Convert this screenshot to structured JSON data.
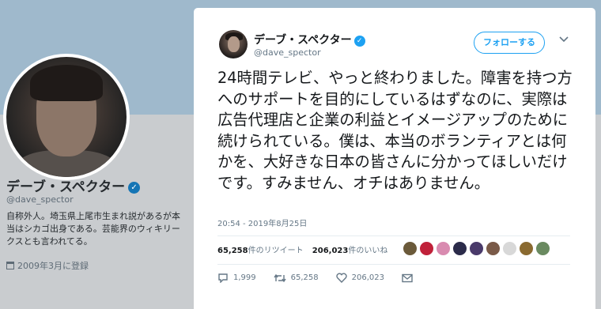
{
  "profile": {
    "name": "デーブ・スペクター",
    "verified_mark": "✓",
    "handle": "@dave_spector",
    "bio": "自称外人。埼玉県上尾市生まれ説があるが本当はシカゴ出身である。芸能界のウィキリークスとも言われてる。",
    "joined": "2009年3月に登録"
  },
  "tweet": {
    "author_name": "デーブ・スペクター",
    "verified_mark": "✓",
    "author_handle": "@dave_spector",
    "follow_label": "フォローする",
    "menu_icon": "chevron-down-icon",
    "text": "24時間テレビ、やっと終わりました。障害を持つ方へのサポートを目的にしているはずなのに、実際は広告代理店と企業の利益とイメージアップのために続けられている。僕は、本当のボランティアとは何かを、大好きな日本の皆さんに分かってほしいだけです。すみません、オチはありません。",
    "timestamp": "20:54 - 2019年8月25日",
    "retweets_count": "65,258",
    "retweets_label": "件のリツイート",
    "likes_count": "206,023",
    "likes_label": "件のいいね",
    "actions": {
      "reply_count": "1,999",
      "retweet_count": "65,258",
      "like_count": "206,023"
    }
  },
  "colors": {
    "accent": "#1da1f2",
    "liker_avatars": [
      "#6b5a3a",
      "#c0213a",
      "#d98bb0",
      "#2b2b4a",
      "#4a3a6a",
      "#7a5a48",
      "#d8d8d8",
      "#8a6a30",
      "#6a8a60"
    ]
  }
}
